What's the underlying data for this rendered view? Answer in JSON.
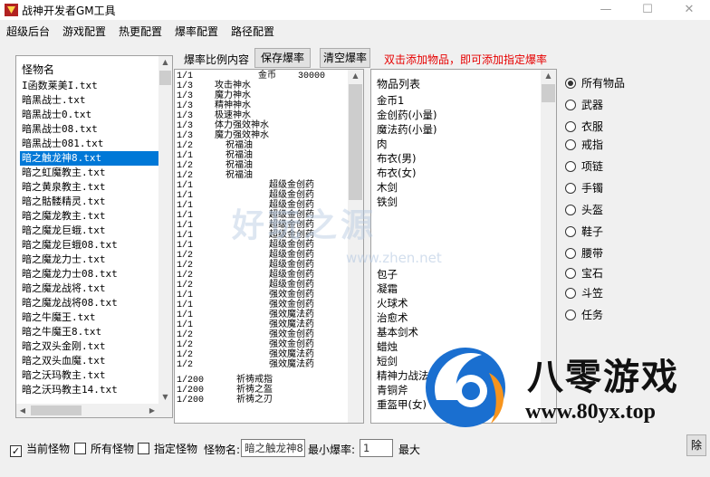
{
  "window": {
    "title": "战神开发者GM工具",
    "minimize": "—",
    "maximize": "☐",
    "close": "✕"
  },
  "menu": {
    "items": [
      "超级后台",
      "游戏配置",
      "热更配置",
      "爆率配置",
      "路径配置"
    ]
  },
  "monster_list": {
    "header": "怪物名",
    "items": [
      "I函数莱美I.txt",
      "暗黑战士.txt",
      "暗黑战士0.txt",
      "暗黑战士08.txt",
      "暗黑战士081.txt",
      "暗之触龙神8.txt",
      "暗之虹魔教主.txt",
      "暗之黄泉教主.txt",
      "暗之骷髅精灵.txt",
      "暗之魔龙教主.txt",
      "暗之魔龙巨蛾.txt",
      "暗之魔龙巨蛾08.txt",
      "暗之魔龙力士.txt",
      "暗之魔龙力士08.txt",
      "暗之魔龙战将.txt",
      "暗之魔龙战将08.txt",
      "暗之牛魔王.txt",
      "暗之牛魔王8.txt",
      "暗之双头金刚.txt",
      "暗之双头血魔.txt",
      "暗之沃玛教主.txt",
      "暗之沃玛教主14.txt"
    ],
    "selected_index": 5
  },
  "rate_panel": {
    "label": "爆率比例内容",
    "save_button": "保存爆率",
    "clear_button": "清空爆率",
    "hint": "双击添加物品，即可添加指定爆率",
    "lines": [
      "1/1            金币    30000",
      "1/3    攻击神水",
      "1/3    魔力神水",
      "1/3    精神神水",
      "1/3    极速神水",
      "1/3    体力强效神水",
      "1/3    魔力强效神水",
      "1/2      祝福油",
      "1/1      祝福油",
      "1/2      祝福油",
      "1/2      祝福油",
      "1/1              超级金创药",
      "1/1              超级金创药",
      "1/1              超级金创药",
      "1/1              超级金创药",
      "1/1              超级金创药",
      "1/1              超级金创药",
      "1/1              超级金创药",
      "1/2              超级金创药",
      "1/2              超级金创药",
      "1/2              超级金创药",
      "1/2              超级金创药",
      "1/1              强效金创药",
      "1/1              强效金创药",
      "1/1              强效魔法药",
      "1/1              强效魔法药",
      "1/2              强效金创药",
      "1/2              强效金创药",
      "1/2              强效魔法药",
      "1/2              强效魔法药",
      "",
      "1/200      祈祷戒指",
      "1/200      祈祷之盔",
      "1/200      祈祷之刃"
    ]
  },
  "item_list": {
    "header": "物品列表",
    "items": [
      "金币1",
      "金创药(小量)",
      "魔法药(小量)",
      "肉",
      "布衣(男)",
      "布衣(女)",
      "木剑",
      "铁剑",
      "",
      "",
      "",
      "",
      "",
      "包子",
      "凝霜",
      "火球术",
      "治愈术",
      "基本剑术",
      "蜡烛",
      "短剑",
      "精神力战法",
      "青铜斧",
      "重盔甲(女)"
    ]
  },
  "categories": {
    "options": [
      "所有物品",
      "武器",
      "衣服",
      "戒指",
      "项链",
      "手镯",
      "头盔",
      "鞋子",
      "腰带",
      "宝石",
      "斗笠",
      "任务"
    ],
    "selected_index": 0
  },
  "bottom": {
    "current_monster": "当前怪物",
    "all_monsters": "所有怪物",
    "specified_monster": "指定怪物",
    "monster_name_label": "怪物名:",
    "monster_name_value": "暗之触龙神8.",
    "min_rate_label": "最小爆率:",
    "min_rate_value": "1",
    "max_label": "最大",
    "delete_button": "除",
    "checkmark": "✓"
  },
  "watermark": {
    "text": "好玩之源",
    "url": "www.zhen.net"
  },
  "brand": {
    "title": "八零游戏",
    "url": "www.80yx.top"
  },
  "colors": {
    "selection": "#0078d7",
    "hint": "#e60000",
    "brand_blue": "#1a6fd0",
    "brand_orange": "#f7941d"
  }
}
